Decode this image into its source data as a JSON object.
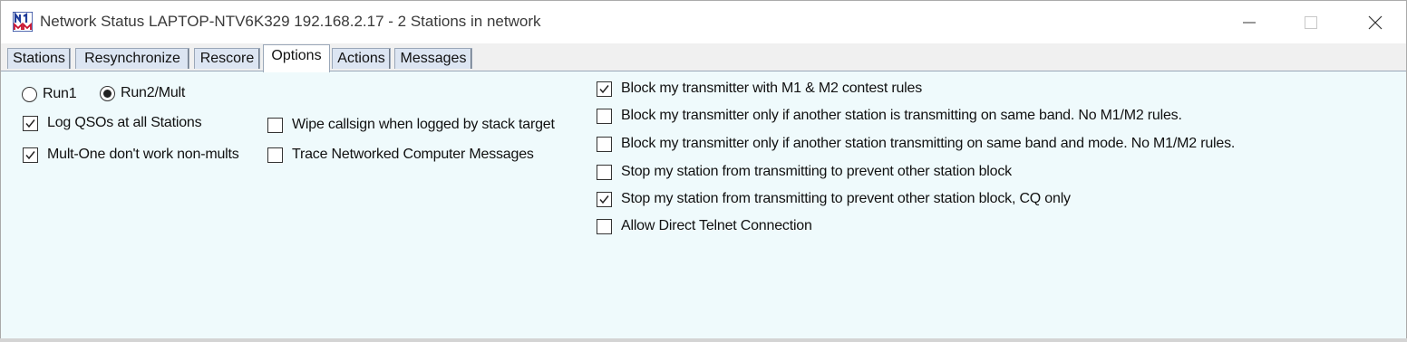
{
  "window": {
    "title": "Network Status LAPTOP-NTV6K329 192.168.2.17 - 2 Stations in network",
    "icon": "n1mm-logo"
  },
  "tabs": [
    {
      "label": "Stations",
      "active": false
    },
    {
      "label": "Resynchronize",
      "active": false
    },
    {
      "label": "Rescore",
      "active": false
    },
    {
      "label": "Options",
      "active": true
    },
    {
      "label": "Actions",
      "active": false
    },
    {
      "label": "Messages",
      "active": false
    }
  ],
  "options": {
    "run_mode": {
      "run1": {
        "label": "Run1",
        "selected": false
      },
      "run2": {
        "label": "Run2/Mult",
        "selected": true
      }
    },
    "left": [
      {
        "label": "Log QSOs at all Stations",
        "checked": true
      },
      {
        "label": "Mult-One don't work non-mults",
        "checked": true
      }
    ],
    "middle": [
      {
        "label": "Wipe callsign when logged by stack target",
        "checked": false
      },
      {
        "label": "Trace Networked Computer Messages",
        "checked": false
      }
    ],
    "right": [
      {
        "label": "Block my transmitter with M1 & M2 contest rules",
        "checked": true
      },
      {
        "label": "Block my transmitter only if another station is transmitting on same band. No M1/M2 rules.",
        "checked": false
      },
      {
        "label": "Block my transmitter only if another station transmitting on same band and mode. No M1/M2 rules.",
        "checked": false
      },
      {
        "label": "Stop my station from transmitting to prevent other station block",
        "checked": false
      },
      {
        "label": "Stop my station from transmitting to prevent other station block, CQ only",
        "checked": true
      },
      {
        "label": "Allow Direct Telnet Connection",
        "checked": false
      }
    ]
  },
  "colors": {
    "panel_bg": "#effafc",
    "tab_bg": "#dce5f2",
    "logo_blue": "#1f3c99",
    "logo_red": "#c8102e"
  }
}
